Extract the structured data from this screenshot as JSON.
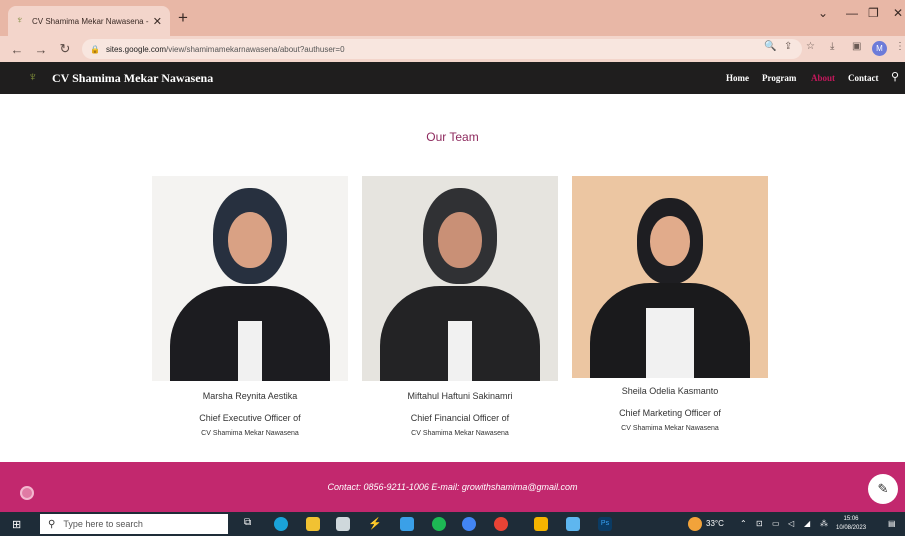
{
  "browser": {
    "tab_title": "CV Shamima Mekar Nawasena - ...",
    "tab_close": "✕",
    "new_tab": "+",
    "url_domain": "sites.google.com",
    "url_path": "/view/shamimamekarnawasena/about?authuser=0",
    "profile_initial": "M",
    "icons": [
      "back-arrow-icon",
      "forward-arrow-icon",
      "reload-icon",
      "lock-icon",
      "zoom-icon",
      "share-icon",
      "star-icon",
      "download-icon",
      "sidepanel-icon",
      "menu-icon"
    ]
  },
  "site": {
    "name": "CV Shamima Mekar Nawasena",
    "nav": [
      "Home",
      "Program",
      "About",
      "Contact"
    ],
    "active_nav": "About"
  },
  "page": {
    "heading": "Our Team",
    "members": [
      {
        "name": "Marsha Reynita Aestika",
        "role": "Chief Executive Officer of",
        "company": "CV Shamima Mekar Nawasena"
      },
      {
        "name": "Miftahul Haftuni Sakinamri",
        "role": "Chief Financial Officer of",
        "company": "CV Shamima Mekar Nawasena"
      },
      {
        "name": "Sheila Odelia Kasmanto",
        "role": "Chief Marketing Officer of",
        "company": "CV Shamima Mekar Nawasena"
      }
    ]
  },
  "footer": {
    "contact": "Contact: 0856-9211-1006 E-mail: growithshamima@gmail.com"
  },
  "taskbar": {
    "search_placeholder": "Type here to search",
    "weather": "33°C",
    "time": "15:06",
    "date": "10/08/2023"
  },
  "colors": {
    "accent": "#c2185b",
    "footer": "#c2286e",
    "header": "#1f1e1e",
    "chrome": "#e8b7a6"
  }
}
